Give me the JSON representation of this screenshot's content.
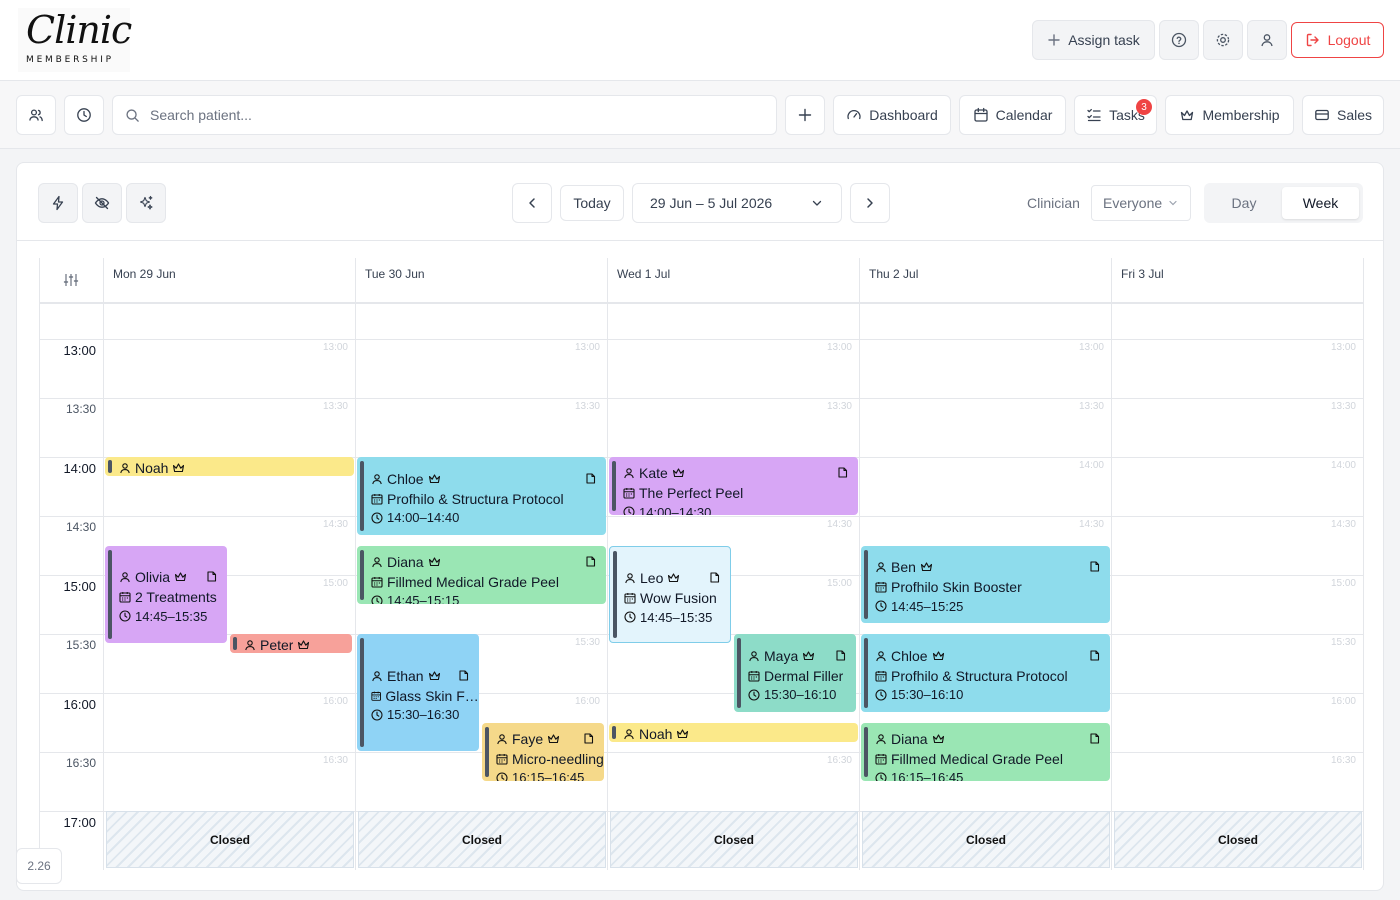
{
  "app": {
    "logo_script": "Clinic",
    "logo_sub": "MEMBERSHIP",
    "version": "2.26"
  },
  "header": {
    "assign_task": "Assign task",
    "logout": "Logout"
  },
  "nav": {
    "search_placeholder": "Search patient...",
    "dashboard": "Dashboard",
    "calendar": "Calendar",
    "tasks": "Tasks",
    "tasks_badge": "3",
    "membership": "Membership",
    "sales": "Sales"
  },
  "toolbar": {
    "today": "Today",
    "date_range": "29 Jun – 5 Jul 2026",
    "clinician_label": "Clinician",
    "clinician_value": "Everyone",
    "view_day": "Day",
    "view_week": "Week",
    "active_view": "Week"
  },
  "calendar": {
    "days": [
      "Mon 29 Jun",
      "Tue 30 Jun",
      "Wed 1 Jul",
      "Thu 2 Jul",
      "Fri 3 Jul"
    ],
    "time_labels": [
      "13:00",
      "13:30",
      "14:00",
      "14:30",
      "15:00",
      "15:30",
      "16:00",
      "16:30",
      "17:00"
    ],
    "closed_label": "Closed",
    "events": [
      {
        "day": 0,
        "patient": "Noah",
        "start": "14:00",
        "end": "14:10",
        "color": "#fbe98a",
        "compact": true
      },
      {
        "day": 0,
        "patient": "Olivia",
        "treatment": "2 Treatments",
        "time": "14:45–15:35",
        "start": "14:45",
        "end": "15:35",
        "color": "#d7a6f5",
        "col": 0,
        "cols": 2
      },
      {
        "day": 0,
        "patient": "Peter",
        "start": "15:30",
        "end": "15:40",
        "color": "#f7a19a",
        "compact": true,
        "col": 1,
        "cols": 2
      },
      {
        "day": 1,
        "patient": "Chloe",
        "treatment": "Profhilo & Structura Protocol",
        "time": "14:00–14:40",
        "start": "14:00",
        "end": "14:40",
        "color": "#8edcec"
      },
      {
        "day": 1,
        "patient": "Diana",
        "treatment": "Fillmed Medical Grade Peel",
        "time": "14:45–15:15",
        "start": "14:45",
        "end": "15:15",
        "color": "#9ae6b4"
      },
      {
        "day": 1,
        "patient": "Ethan",
        "treatment": "Glass Skin Facial",
        "time": "15:30–16:30",
        "start": "15:30",
        "end": "16:30",
        "color": "#8fd3f5",
        "col": 0,
        "cols": 2
      },
      {
        "day": 1,
        "patient": "Faye",
        "treatment": "Micro-needling",
        "time": "16:15–16:45",
        "start": "16:15",
        "end": "16:45",
        "color": "#f5d98a",
        "col": 1,
        "cols": 2
      },
      {
        "day": 2,
        "patient": "Kate",
        "treatment": "The Perfect Peel",
        "time": "14:00–14:30",
        "start": "14:00",
        "end": "14:30",
        "color": "#d7a6f5"
      },
      {
        "day": 2,
        "patient": "Leo",
        "treatment": "Wow Fusion",
        "time": "14:45–15:35",
        "start": "14:45",
        "end": "15:35",
        "color": "#e3f4fc",
        "border": "#7fcde9",
        "col": 0,
        "cols": 2
      },
      {
        "day": 2,
        "patient": "Maya",
        "treatment": "Dermal Filler",
        "time": "15:30–16:10",
        "start": "15:30",
        "end": "16:10",
        "color": "#8ddcc8",
        "col": 1,
        "cols": 2
      },
      {
        "day": 2,
        "patient": "Noah",
        "start": "16:15",
        "end": "16:25",
        "color": "#fbe98a",
        "compact": true
      },
      {
        "day": 3,
        "patient": "Ben",
        "treatment": "Profhilo Skin Booster",
        "time": "14:45–15:25",
        "start": "14:45",
        "end": "15:25",
        "color": "#8edcec"
      },
      {
        "day": 3,
        "patient": "Chloe",
        "treatment": "Profhilo & Structura Protocol",
        "time": "15:30–16:10",
        "start": "15:30",
        "end": "16:10",
        "color": "#8edcec"
      },
      {
        "day": 3,
        "patient": "Diana",
        "treatment": "Fillmed Medical Grade Peel",
        "time": "16:15–16:45",
        "start": "16:15",
        "end": "16:45",
        "color": "#9ae6b4"
      }
    ]
  }
}
